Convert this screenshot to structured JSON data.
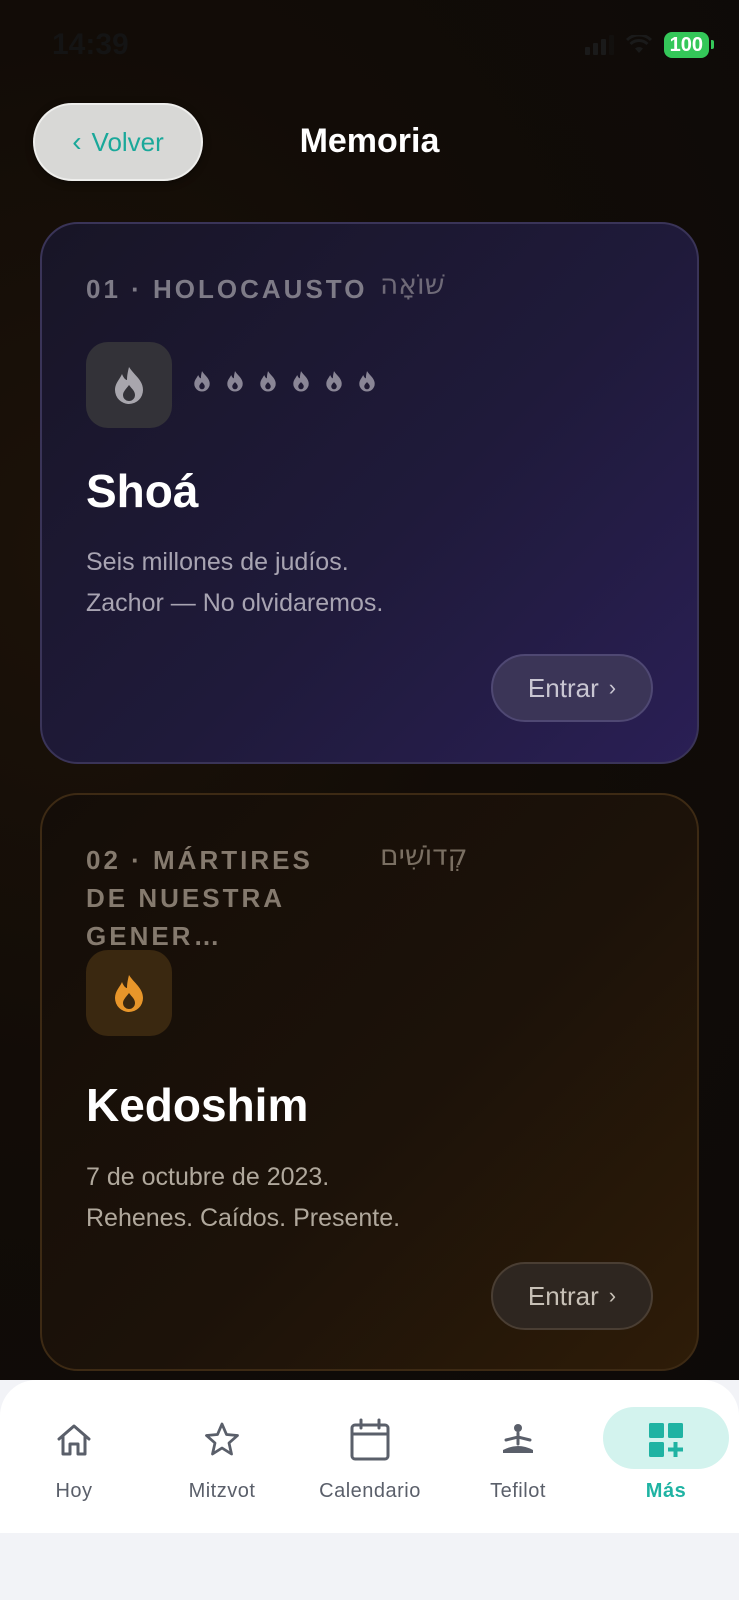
{
  "status_bar": {
    "time": "14:39",
    "battery": "100"
  },
  "header": {
    "back_label": "Volver",
    "title": "Memoria"
  },
  "cards": [
    {
      "kicker": "01 · HOLOCAUSTO",
      "hebrew": "שׁוֹאָה",
      "title": "Shoá",
      "desc_line1": "Seis millones de judíos.",
      "desc_line2": "Zachor — No olvidaremos.",
      "button": "Entrar",
      "flame_count": 6,
      "accent": "#9a96a6"
    },
    {
      "kicker": "02 · MÁRTIRES DE NUESTRA GENER…",
      "hebrew": "קְדוֹשִׁים",
      "title": "Kedoshim",
      "desc_line1": "7 de octubre de 2023.",
      "desc_line2": "Rehenes. Caídos. Presente.",
      "button": "Entrar",
      "accent": "#e8962a"
    }
  ],
  "tabbar": {
    "items": [
      {
        "label": "Hoy",
        "icon": "home-icon"
      },
      {
        "label": "Mitzvot",
        "icon": "star-icon"
      },
      {
        "label": "Calendario",
        "icon": "calendar-icon"
      },
      {
        "label": "Tefilot",
        "icon": "prayer-icon"
      },
      {
        "label": "Más",
        "icon": "grid-plus-icon",
        "active": true
      }
    ],
    "active_color": "#1fb3a3"
  }
}
